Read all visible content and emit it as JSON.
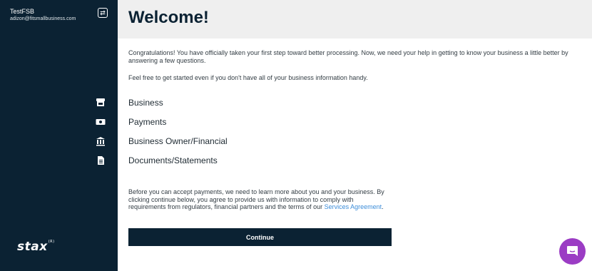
{
  "account": {
    "name": "TestFSB",
    "email": "adizon@fitsmallbusiness.com",
    "switch_icon": "swap-icon"
  },
  "sidebar": {
    "icons": [
      "store-icon",
      "cash-icon",
      "bank-icon",
      "document-icon"
    ],
    "logo": "stax",
    "logo_mark": "(R)"
  },
  "header": {
    "title": "Welcome!"
  },
  "main": {
    "intro_1": "Congratulations! You have officially taken your first step toward better processing. Now, we need your help in getting to know your business a little better by answering a few questions.",
    "intro_2": "Feel free to get started even if you don't have all of your business information handy.",
    "sections": [
      "Business",
      "Payments",
      "Business Owner/Financial",
      "Documents/Statements"
    ],
    "legal_text": "Before you can accept payments, we need to learn more about you and your business. By clicking continue below, you agree to provide us with information to comply with requirements from regulators, financial partners and the terms of our ",
    "legal_link": "Services Agreement",
    "legal_end": ".",
    "continue_label": "Continue"
  },
  "colors": {
    "sidebar": "#0b2233",
    "header": "#efefef",
    "link": "#3c8dd9",
    "chat": "#9b3cc4"
  }
}
